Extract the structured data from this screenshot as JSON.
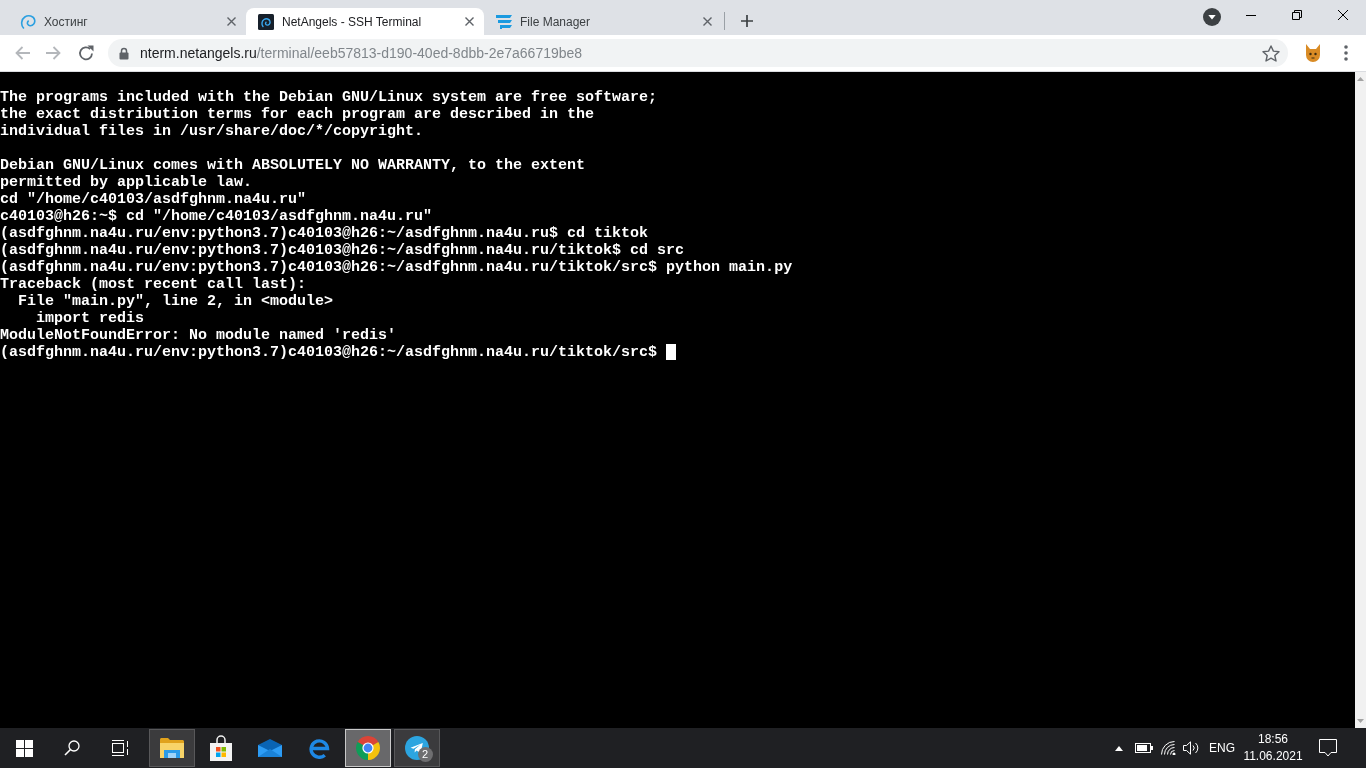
{
  "browser": {
    "tabs": [
      {
        "kind": "hosting",
        "title": "Хостинг",
        "selected": false
      },
      {
        "kind": "terminal",
        "title": "NetAngels - SSH Terminal",
        "selected": true
      },
      {
        "kind": "files",
        "title": "File Manager",
        "selected": false
      }
    ],
    "nav_buttons": [
      {
        "kind": "back",
        "disabled": true
      },
      {
        "kind": "forward",
        "disabled": true
      },
      {
        "kind": "reload",
        "disabled": false
      }
    ],
    "address_bar": {
      "host": "nterm.netangels.ru",
      "path": "/terminal/eeb57813-d190-40ed-8dbb-2e7a66719be8",
      "bookmarked": false
    }
  },
  "terminal": {
    "blocks": [
      [
        "The programs included with the Debian GNU/Linux system are free software;",
        "the exact distribution terms for each program are described in the",
        "individual files in /usr/share/doc/*/copyright."
      ],
      [
        "Debian GNU/Linux comes with ABSOLUTELY NO WARRANTY, to the extent",
        "permitted by applicable law.",
        "cd \"/home/c40103/asdfghnm.na4u.ru\"",
        "c40103@h26:~$ cd \"/home/c40103/asdfghnm.na4u.ru\"",
        "(asdfghnm.na4u.ru/env:python3.7)c40103@h26:~/asdfghnm.na4u.ru$ cd tiktok",
        "(asdfghnm.na4u.ru/env:python3.7)c40103@h26:~/asdfghnm.na4u.ru/tiktok$ cd src",
        "(asdfghnm.na4u.ru/env:python3.7)c40103@h26:~/asdfghnm.na4u.ru/tiktok/src$ python main.py",
        "Traceback (most recent call last):",
        "  File \"main.py\", line 2, in <module>",
        "    import redis",
        "ModuleNotFoundError: No module named 'redis'",
        "(asdfghnm.na4u.ru/env:python3.7)c40103@h26:~/asdfghnm.na4u.ru/tiktok/src$"
      ]
    ],
    "cursor": true
  },
  "taskbar": {
    "apps": [
      {
        "kind": "explorer",
        "running": true,
        "active": false
      },
      {
        "kind": "store",
        "running": false,
        "active": false
      },
      {
        "kind": "mail",
        "running": false,
        "active": false
      },
      {
        "kind": "edge",
        "running": false,
        "active": false
      },
      {
        "kind": "chrome",
        "running": true,
        "active": true
      },
      {
        "kind": "telegram",
        "running": true,
        "active": false,
        "badge": "2"
      }
    ],
    "tray": {
      "language": "ENG",
      "time": "18:56",
      "date": "11.06.2021"
    }
  }
}
